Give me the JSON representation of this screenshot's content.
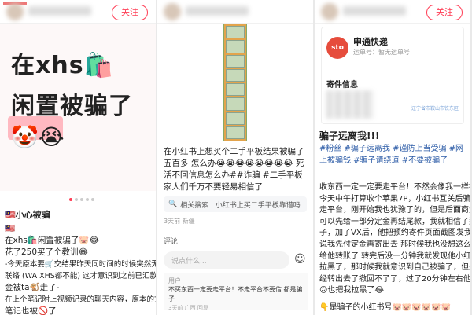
{
  "panel1": {
    "follow_label": "关注",
    "cover_line1": "在xhs🛍️",
    "cover_line2": "闲置被骗了",
    "cover_emojis": "🤡😭",
    "title": "🇲🇾小心被骗",
    "body": [
      "🇲🇾",
      "在xhs🛍️闲置被骗了🐷😂",
      "花了250买了个教训😂",
      "-今天原本要🛒交结果昨天同时间的时候突然无法",
      "联络 (WA XHS都不能) 这才意识到之前已汇款的订",
      "金被ta🐒走了-",
      "在上个笔记附上视频记录的聊天内容，原本的文字",
      "笔记也被🚫了"
    ]
  },
  "panel2": {
    "post_text": "在小红书上想买个二手平板结果被骗了五百多 怎么办😭😭😭😭😭😭😭😭 死活不回信息怎么办##诈骗 #二手平板  家人们千万不要轻易相信了",
    "search_label": "相关搜索 · 小红书上买二手平板靠谱吗",
    "meta": "3天前 新疆",
    "comment_label": "评论",
    "input_placeholder": "说点什么...",
    "reply_name": "用户",
    "reply_text": "不买东西一定要走平台！不走平台不要信 都是骗子",
    "reply_time": "3天前 广西 回复"
  },
  "panel3": {
    "follow_label": "关注",
    "carrier": "申通快递",
    "tracking": "运单号：暂无运单号",
    "logo": "sto",
    "info_label": "寄件信息",
    "address": "辽宁省市鞍山市铁东区",
    "title": "骗子远离我!!!",
    "tags": "#粉丝 #骗子远离我 #谨防上当受骗 #网上被骗钱 #骗子请绕道 #不要被骗了",
    "body": [
      "收东西一定一定要走平台！不然会像我一样被骗，",
      "今天中午打算收个苹果7P，小红书互关后骗子说不",
      "走平台，刚开始我也犹豫了的，但是后面商量了说",
      "可以先给一部分定金再结尾款，我就相信了那个骗",
      "子，加了VX后，他把预约寄件页面截图发我看了",
      "说我先付定金再寄出去 那时候我也没想这么多 直接",
      "给他转账了 转完后没一分钟我就发现他小红书把我",
      "拉黑了，那时候我就意识到自己被骗了，但是钱已",
      "经转出去了撤回不了了，过了20分钟左右他接收了",
      "🙃也把我拉黑了😂"
    ],
    "footer": "👇是骗子的小红书号🐷🐷🐷🐷🐷🐷"
  },
  "colors": {
    "accent": "#ff3d55",
    "tag": "#2a5aa6"
  }
}
